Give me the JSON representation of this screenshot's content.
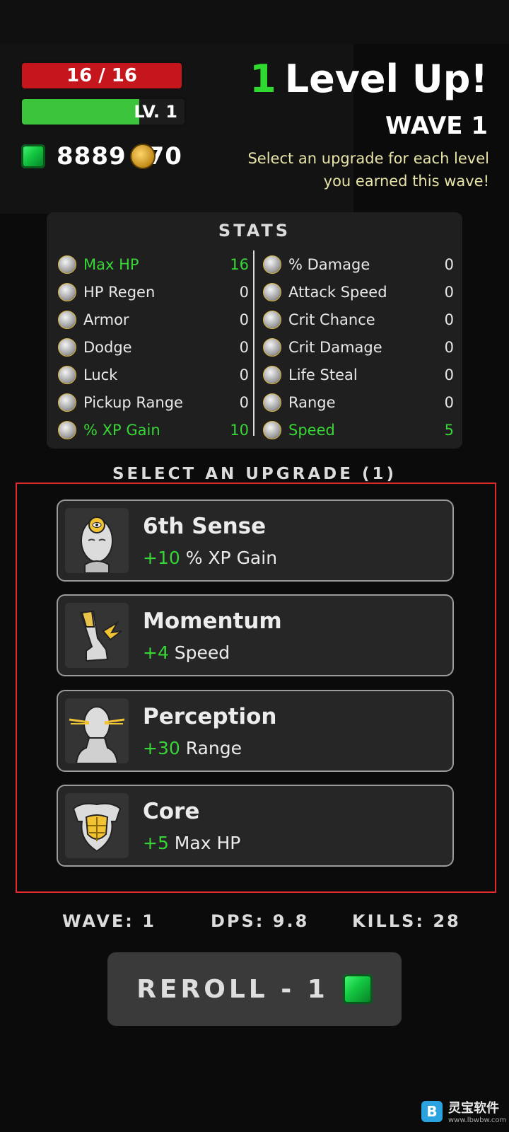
{
  "hud": {
    "hp_text": "16 / 16",
    "hp_fraction": 1.0,
    "level_text": "LV. 1",
    "xp_fraction": 0.72,
    "money_text": "8889",
    "money_text_after": "70"
  },
  "header": {
    "levelup_count": "1",
    "levelup_label": "Level Up!",
    "wave_label": "WAVE 1",
    "hint_line1": "Select an upgrade for each level",
    "hint_line2": "you earned this wave!"
  },
  "stats": {
    "title": "STATS",
    "left": [
      {
        "name": "Max HP",
        "value": "16",
        "highlight": true,
        "icon": "heart-bust-icon"
      },
      {
        "name": "HP Regen",
        "value": "0",
        "highlight": false,
        "icon": "regen-icon"
      },
      {
        "name": "Armor",
        "value": "0",
        "highlight": false,
        "icon": "armor-icon"
      },
      {
        "name": "Dodge",
        "value": "0",
        "highlight": false,
        "icon": "dodge-icon"
      },
      {
        "name": "Luck",
        "value": "0",
        "highlight": false,
        "icon": "luck-icon"
      },
      {
        "name": "Pickup Range",
        "value": "0",
        "highlight": false,
        "icon": "pickup-hand-icon"
      },
      {
        "name": "% XP Gain",
        "value": "10",
        "highlight": true,
        "icon": "xp-head-icon"
      }
    ],
    "right": [
      {
        "name": "% Damage",
        "value": "0",
        "highlight": false,
        "icon": "muscle-arm-icon"
      },
      {
        "name": "Attack Speed",
        "value": "0",
        "highlight": false,
        "icon": "attack-speed-icon"
      },
      {
        "name": "Crit Chance",
        "value": "0",
        "highlight": false,
        "icon": "crit-chance-icon"
      },
      {
        "name": "Crit Damage",
        "value": "0",
        "highlight": false,
        "icon": "crit-damage-icon"
      },
      {
        "name": "Life Steal",
        "value": "0",
        "highlight": false,
        "icon": "life-steal-icon"
      },
      {
        "name": "Range",
        "value": "0",
        "highlight": false,
        "icon": "range-head-icon"
      },
      {
        "name": "Speed",
        "value": "5",
        "highlight": true,
        "icon": "winged-leg-icon"
      }
    ]
  },
  "upgrades": {
    "title": "SELECT AN UPGRADE (1)",
    "cards": [
      {
        "name": "6th Sense",
        "plus": "+10",
        "stat": " % XP Gain",
        "icon": "third-eye-head-icon"
      },
      {
        "name": "Momentum",
        "plus": "+4",
        "stat": " Speed",
        "icon": "winged-leg-icon"
      },
      {
        "name": "Perception",
        "plus": "+30",
        "stat": " Range",
        "icon": "lightning-eyes-head-icon"
      },
      {
        "name": "Core",
        "plus": "+5",
        "stat": " Max HP",
        "icon": "golden-torso-icon"
      }
    ]
  },
  "footer": {
    "wave": "WAVE: 1",
    "dps": "DPS: 9.8",
    "kills": "KILLS: 28",
    "reroll_label": "REROLL - 1"
  },
  "watermark": {
    "name": "灵宝软件",
    "url": "www.lbwbw.com"
  },
  "colors": {
    "background": "#0b0b0b",
    "hp_red": "#c4161c",
    "xp_green": "#3cc43c",
    "highlight_green": "#37d637",
    "hint_yellow": "#e8e4a8",
    "frame_red": "#e12a2a"
  }
}
